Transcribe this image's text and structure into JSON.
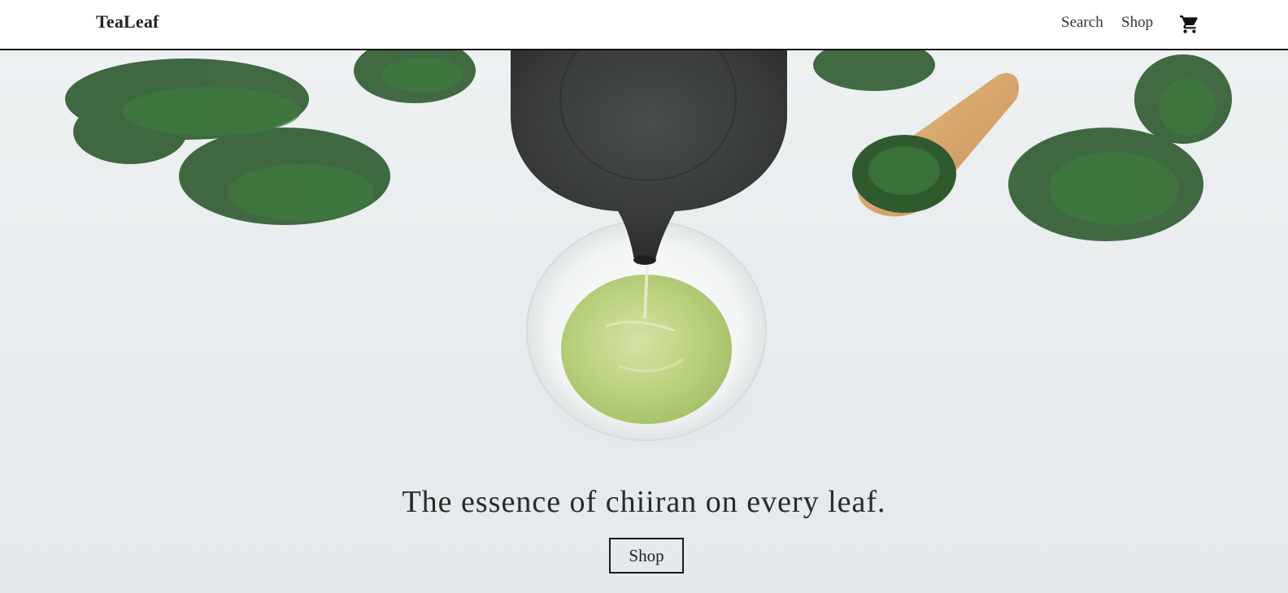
{
  "header": {
    "logo": "TeaLeaf",
    "nav": {
      "search": "Search",
      "shop": "Shop"
    },
    "cart_icon": "shopping-cart-icon"
  },
  "hero": {
    "headline": "The essence of chiiran on every leaf.",
    "button_label": "Shop"
  },
  "colors": {
    "text": "#222222",
    "tea_green": "#a9c466",
    "leaf_green": "#2f5a2e",
    "kettle": "#3a3d3b",
    "scoop": "#d9a86a"
  }
}
